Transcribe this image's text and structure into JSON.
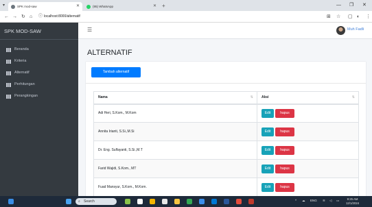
{
  "browser": {
    "tabs": [
      {
        "title": "SPK mod-saw",
        "active": true
      },
      {
        "title": "(95) WhatsApp",
        "active": false
      }
    ],
    "url": "localhost:8000/alternatif"
  },
  "sidebar": {
    "brand": "SPK MOD-SAW",
    "items": [
      {
        "label": "Beranda"
      },
      {
        "label": "Kriteria"
      },
      {
        "label": "Alternatif"
      },
      {
        "label": "Perhitungan"
      },
      {
        "label": "Perangkingan"
      }
    ]
  },
  "header": {
    "username": "Muh Fadli"
  },
  "page": {
    "title": "ALTERNATIF",
    "add_button": "Tambah alternatif",
    "table": {
      "columns": [
        "Nama",
        "Aksi"
      ],
      "edit_label": "Edit",
      "delete_label": "hapus",
      "rows": [
        {
          "name": "Adi Heri, S.Kom., M.Kom"
        },
        {
          "name": "Annita Irianti, S.Si.,M.Si"
        },
        {
          "name": "Dr. Eng. Sulfayanti, S.Si.,M.T"
        },
        {
          "name": "Farid Wajidi, S.Kom., MT"
        },
        {
          "name": "Fuad Mansyur, S.Kom., M.Kom."
        }
      ]
    }
  },
  "taskbar": {
    "search_placeholder": "Search",
    "language": "ENG",
    "time": "9:25 AM",
    "date": "12/1/2024"
  },
  "colors": {
    "sidebar_bg": "#343a40",
    "primary": "#007bff",
    "info": "#17a2b8",
    "danger": "#dc3545",
    "content_bg": "#f4f6f9"
  }
}
